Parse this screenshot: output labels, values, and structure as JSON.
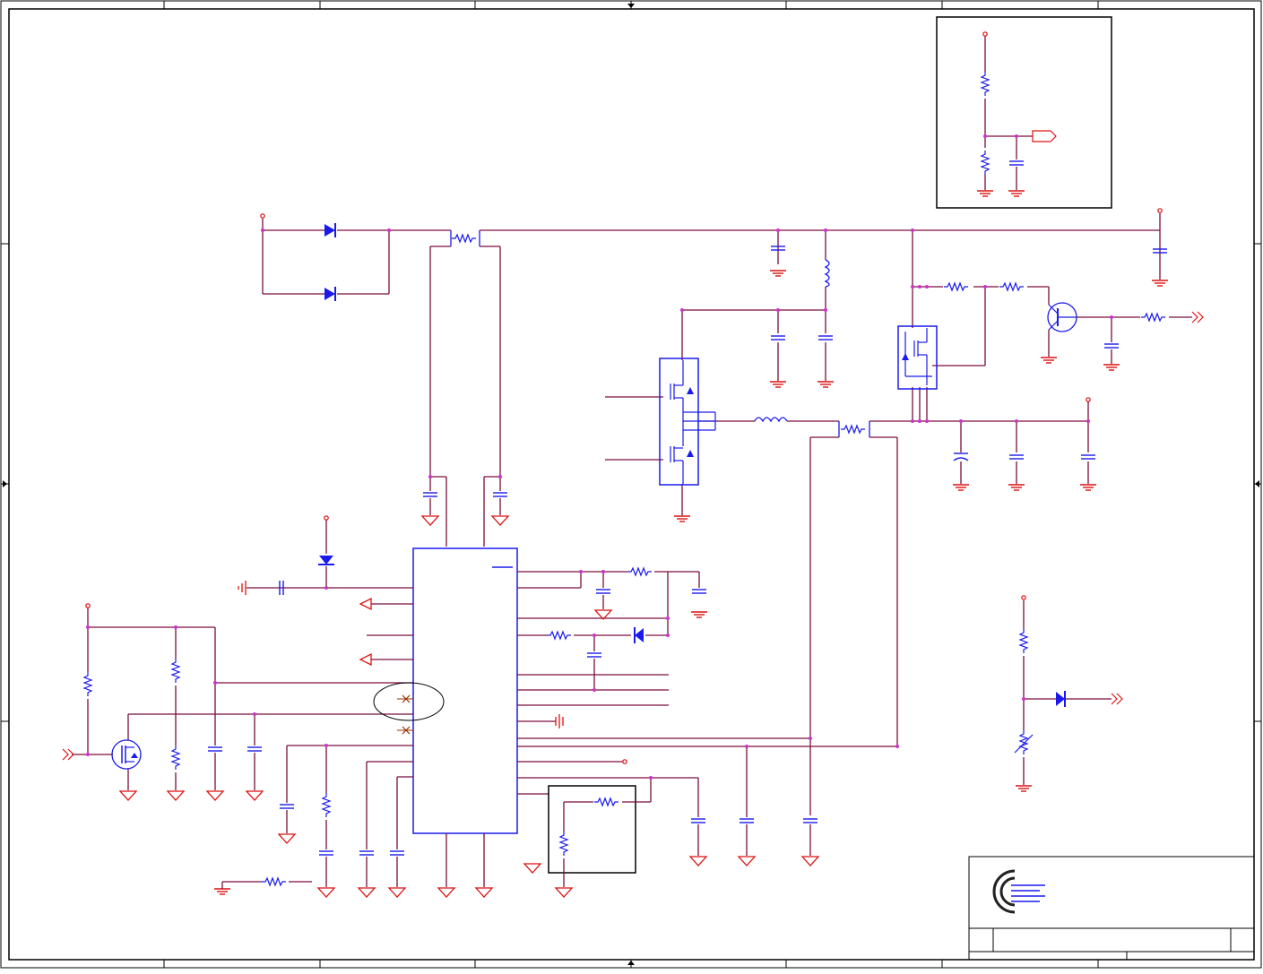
{
  "schematic": {
    "description_note": "",
    "colors": {
      "wire": "#7a0f3c",
      "net_dot": "#cc33cc",
      "component": "#1a1aee",
      "ground": "#dd1111",
      "border": "#000000",
      "marker": "#993300"
    },
    "title_block": {
      "logo_icon": "company-logo-icon",
      "text": ""
    }
  }
}
